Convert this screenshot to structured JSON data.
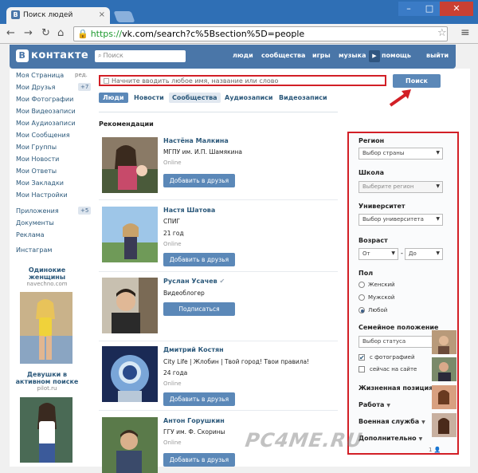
{
  "browser": {
    "tab_title": "Поиск людей",
    "url_scheme": "https://",
    "url_rest": "vk.com/search?c%5Bsection%5D=people"
  },
  "vk": {
    "logo": "контакте",
    "search_placeholder": "Поиск",
    "nav": [
      "люди",
      "сообщества",
      "игры",
      "музыка",
      "помощь",
      "выйти"
    ]
  },
  "left_nav": [
    {
      "label": "Моя Страница",
      "extra": "ред."
    },
    {
      "label": "Мои Друзья",
      "count": "+7"
    },
    {
      "label": "Мои Фотографии"
    },
    {
      "label": "Мои Видеозаписи"
    },
    {
      "label": "Мои Аудиозаписи"
    },
    {
      "label": "Мои Сообщения"
    },
    {
      "label": "Мои Группы"
    },
    {
      "label": "Мои Новости"
    },
    {
      "label": "Мои Ответы"
    },
    {
      "label": "Мои Закладки"
    },
    {
      "label": "Мои Настройки"
    },
    {
      "label": "Приложения",
      "count": "+5"
    },
    {
      "label": "Документы"
    },
    {
      "label": "Реклама"
    },
    {
      "label": "Инстаграм"
    }
  ],
  "ads": [
    {
      "title1": "Одинокие",
      "title2": "женщины",
      "sub": "navechno.com"
    },
    {
      "title1": "Девушки в",
      "title2": "активном поиске",
      "sub": "pilot.ru"
    }
  ],
  "search": {
    "placeholder": "Начните вводить любое имя, название или слово",
    "button": "Поиск"
  },
  "tabs": [
    "Люди",
    "Новости",
    "Сообщества",
    "Аудиозаписи",
    "Видеозаписи"
  ],
  "recommendations_title": "Рекомендации",
  "people": [
    {
      "name": "Настёна Малкина",
      "line1": "МГПУ им. И.П. Шамякина",
      "line2": "",
      "online": "Online",
      "button": "Добавить в друзья"
    },
    {
      "name": "Настя Шатова",
      "line1": "СПИГ",
      "line2": "21 год",
      "online": "Online",
      "button": "Добавить в друзья"
    },
    {
      "name": "Руслан Усачев",
      "line1": "Видеоблогер",
      "line2": "",
      "online": "",
      "button": "Подписаться"
    },
    {
      "name": "Дмитрий Костян",
      "line1": "City Life | Жлобин | Твой город! Твои правила!",
      "line2": "24 года",
      "online": "Online",
      "button": "Добавить в друзья"
    },
    {
      "name": "Антон Горушкин",
      "line1": "ГГУ им. Ф. Скорины",
      "line2": "",
      "online": "Online",
      "button": "Добавить в друзья"
    }
  ],
  "filters": {
    "region": {
      "label": "Регион",
      "value": "Выбор страны"
    },
    "school": {
      "label": "Школа",
      "value": "Выберите регион"
    },
    "university": {
      "label": "Университет",
      "value": "Выбор университета"
    },
    "age": {
      "label": "Возраст",
      "from": "От",
      "dash": "-",
      "to": "До"
    },
    "sex": {
      "label": "Пол",
      "options": [
        "Женский",
        "Мужской",
        "Любой"
      ],
      "selected": "Любой"
    },
    "marital": {
      "label": "Семейное положение",
      "value": "Выбор статуса"
    },
    "with_photo": "с фотографией",
    "online_now": "сейчас на сайте",
    "life_position": "Жизненная позиция",
    "work": "Работа",
    "military": "Военная служба",
    "more": "Дополнительно"
  },
  "counter": "1",
  "watermark": "PC4ME.RU"
}
